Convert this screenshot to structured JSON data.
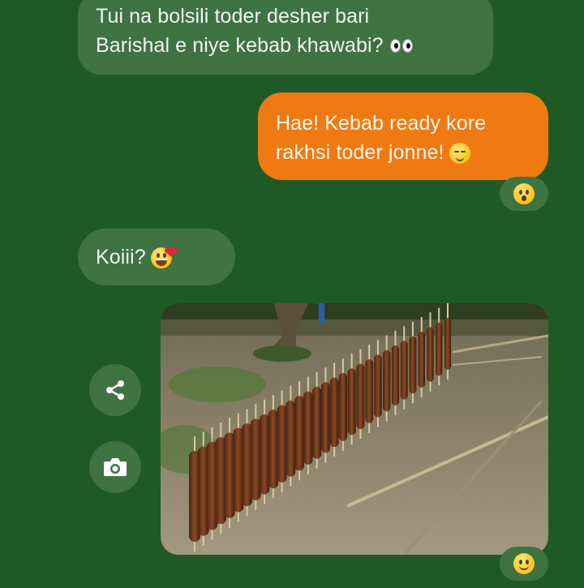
{
  "messages": [
    {
      "direction": "incoming",
      "lines": [
        "Tui na bolsili toder desher bari",
        "Barishal e niye kebab khawabi?"
      ],
      "emoji": "eyes-icon"
    },
    {
      "direction": "outgoing",
      "lines": [
        "Hae! Kebab ready kore",
        "rakhsi toder jonne!"
      ],
      "emoji": "relieved-face-icon",
      "reaction": "astonished-face-icon"
    },
    {
      "direction": "incoming",
      "lines": [
        "Koiii?"
      ],
      "emoji": [
        "grinning-face-icon",
        "heart-icon"
      ]
    },
    {
      "direction": "incoming",
      "type": "image",
      "image": "photo-kebab-skewers-fence",
      "reaction": "smiling-face-icon"
    }
  ],
  "actions": [
    {
      "name": "share",
      "icon": "share-icon"
    },
    {
      "name": "camera",
      "icon": "camera-icon"
    }
  ],
  "colors": {
    "background": "#1f5a26",
    "incoming_bubble": "#3f7342",
    "outgoing_bubble": "#f07a12",
    "text": "#f2f5f1"
  }
}
